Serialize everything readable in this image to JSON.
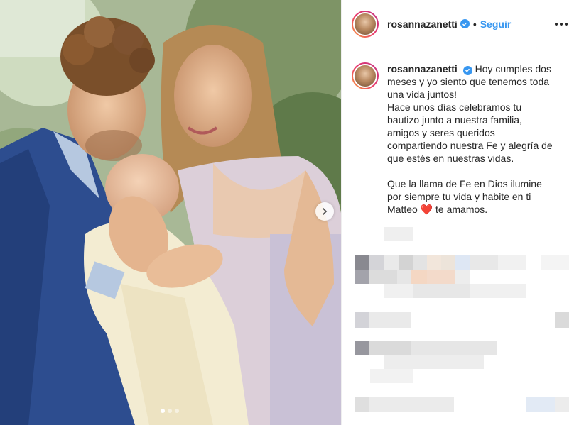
{
  "post": {
    "username": "rosannazanetti",
    "separator": "•",
    "follow_label": "Seguir",
    "caption_lines": [
      "Hoy cumples dos",
      "meses y yo siento que tenemos toda",
      "una vida juntos!",
      "Hace unos días celebramos tu",
      "bautizo junto a nuestra familia,",
      "amigos y seres queridos",
      "compartiendo nuestra Fe y alegría de",
      "que estés en nuestras vidas.",
      "",
      "Que la llama de Fe en Dios ilumine",
      "por siempre tu vida y habite en ti",
      "Matteo",
      "te amamos."
    ],
    "heart_emoji": "❤️"
  },
  "carousel": {
    "total_slides": 3,
    "active_slide": 1
  },
  "colors": {
    "accent": "#3897f0",
    "text": "#262626",
    "border": "#efefef",
    "heart": "#ed4956"
  },
  "icons": {
    "verified": "verified-badge-icon",
    "more": "more-options-icon",
    "next": "chevron-right-icon"
  }
}
